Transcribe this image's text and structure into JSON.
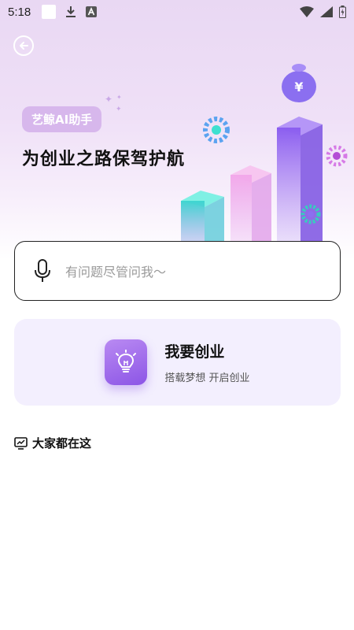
{
  "status_bar": {
    "time": "5:18",
    "icons": [
      "notification-square-icon",
      "download-icon",
      "font-a-icon",
      "wifi-icon",
      "signal-icon",
      "battery-icon"
    ]
  },
  "hero": {
    "badge": "艺鲸AI助手",
    "title": "为创业之路保驾护航",
    "back_icon": "back-arrow-circle-icon",
    "colors": {
      "badge_bg": "#d7b7ec",
      "accent": "#8c55e6"
    }
  },
  "search": {
    "placeholder": "有问题尽管问我～",
    "icon": "microphone-icon"
  },
  "startup_card": {
    "title": "我要创业",
    "subtitle": "搭载梦想 开启创业",
    "icon": "lightbulb-icon"
  },
  "section": {
    "title": "大家都在这",
    "icon": "chart-monitor-icon"
  }
}
